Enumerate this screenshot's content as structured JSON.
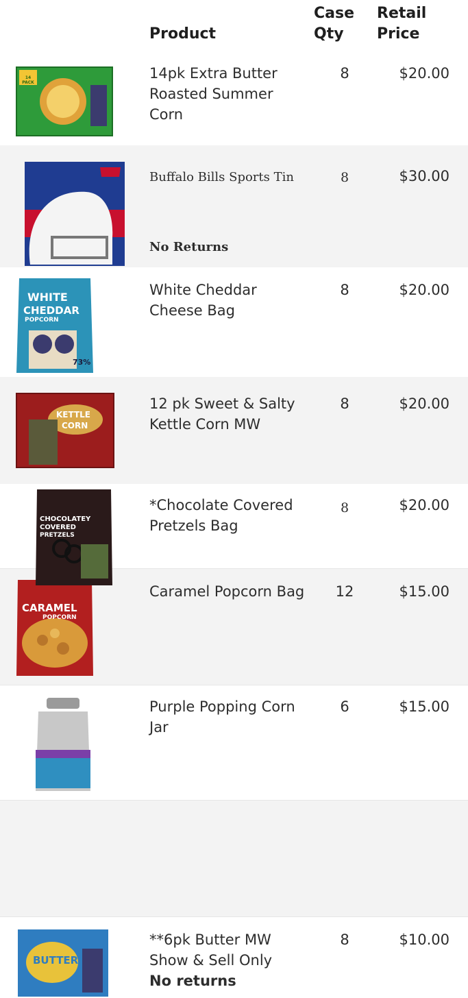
{
  "header": {
    "product": "Product",
    "case_qty_1": "Case",
    "case_qty_2": "Qty",
    "retail_1": "Retail",
    "retail_2": "Price"
  },
  "rows": [
    {
      "name": "14pk Extra Butter Roasted Summer Corn",
      "qty": "8",
      "price": "$20.00",
      "image": "box-14pk-icon"
    },
    {
      "name": "Buffalo Bills Sports Tin",
      "note": "No Returns",
      "qty": "8",
      "price": "$30.00",
      "image": "bills-tin-icon"
    },
    {
      "name": "White Cheddar Cheese  Bag",
      "qty": "8",
      "price": "$20.00",
      "image": "white-cheddar-bag-icon"
    },
    {
      "name": "12 pk Sweet & Salty Kettle Corn MW",
      "qty": "8",
      "price": "$20.00",
      "image": "kettle-corn-box-icon"
    },
    {
      "name": "*Chocolate Covered Pretzels Bag",
      "qty": "8",
      "price": "$20.00",
      "image": "chocolate-pretzels-bag-icon"
    },
    {
      "name": "Caramel Popcorn Bag",
      "qty": "12",
      "price": "$15.00",
      "image": "caramel-popcorn-bag-icon"
    },
    {
      "name": "Purple Popping Corn Jar",
      "qty": "6",
      "price": "$15.00",
      "image": "popcorn-jar-icon"
    },
    {
      "name": "**6pk Butter MW Show & Sell Only",
      "note": "No returns",
      "qty": "8",
      "price": "$10.00",
      "image": "butter-box-icon"
    }
  ],
  "product_labels": {
    "pack14": "14 PACK",
    "white": "WHITE",
    "cheddar": "CHEDDAR",
    "popcorn": "POPCORN",
    "kettle": "KETTLE",
    "corn": "CORN",
    "chocolatey": "CHOCOLATEY",
    "covered": "COVERED",
    "pretzels": "PRETZELS",
    "caramel": "CARAMEL",
    "butter": "BUTTER",
    "pct": "73%"
  }
}
